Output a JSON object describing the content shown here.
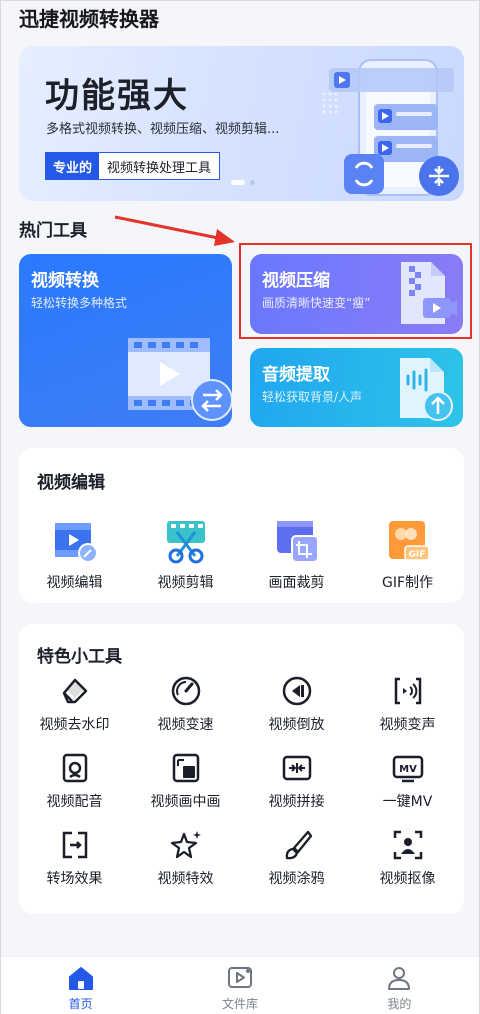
{
  "app": {
    "title": "迅捷视频转换器"
  },
  "banner": {
    "title": "功能强大",
    "subtitle": "多格式视频转换、视频压缩、视频剪辑...",
    "tag_left": "专业的",
    "tag_right": "视频转换处理工具"
  },
  "hot": {
    "title": "热门工具",
    "convert": {
      "title": "视频转换",
      "subtitle": "轻松转换多种格式"
    },
    "compress": {
      "title": "视频压缩",
      "subtitle": "画质清晰快速变“瘦”"
    },
    "audio": {
      "title": "音频提取",
      "subtitle": "轻松获取背景/人声"
    }
  },
  "edit_section": {
    "title": "视频编辑",
    "items": [
      {
        "label": "视频编辑",
        "icon": "video-edit-icon"
      },
      {
        "label": "视频剪辑",
        "icon": "scissors-icon"
      },
      {
        "label": "画面裁剪",
        "icon": "crop-icon"
      },
      {
        "label": "GIF制作",
        "icon": "gif-icon"
      }
    ]
  },
  "tools_section": {
    "title": "特色小工具",
    "items": [
      {
        "label": "视频去水印",
        "icon": "eraser-icon"
      },
      {
        "label": "视频变速",
        "icon": "speed-icon"
      },
      {
        "label": "视频倒放",
        "icon": "rewind-icon"
      },
      {
        "label": "视频变声",
        "icon": "voice-change-icon"
      },
      {
        "label": "视频配音",
        "icon": "dubbing-icon"
      },
      {
        "label": "视频画中画",
        "icon": "picture-in-picture-icon"
      },
      {
        "label": "视频拼接",
        "icon": "merge-icon"
      },
      {
        "label": "一键MV",
        "icon": "mv-icon"
      },
      {
        "label": "转场效果",
        "icon": "transition-icon"
      },
      {
        "label": "视频特效",
        "icon": "sparkle-icon"
      },
      {
        "label": "视频涂鸦",
        "icon": "brush-icon"
      },
      {
        "label": "视频抠像",
        "icon": "portrait-cutout-icon"
      }
    ]
  },
  "nav": {
    "items": [
      {
        "label": "首页",
        "icon": "home-icon",
        "active": true
      },
      {
        "label": "文件库",
        "icon": "file-library-icon",
        "active": false
      },
      {
        "label": "我的",
        "icon": "profile-icon",
        "active": false
      }
    ]
  },
  "colors": {
    "accent": "#2458e6",
    "highlight": "#e5332a",
    "arrow": "#e5332a"
  }
}
